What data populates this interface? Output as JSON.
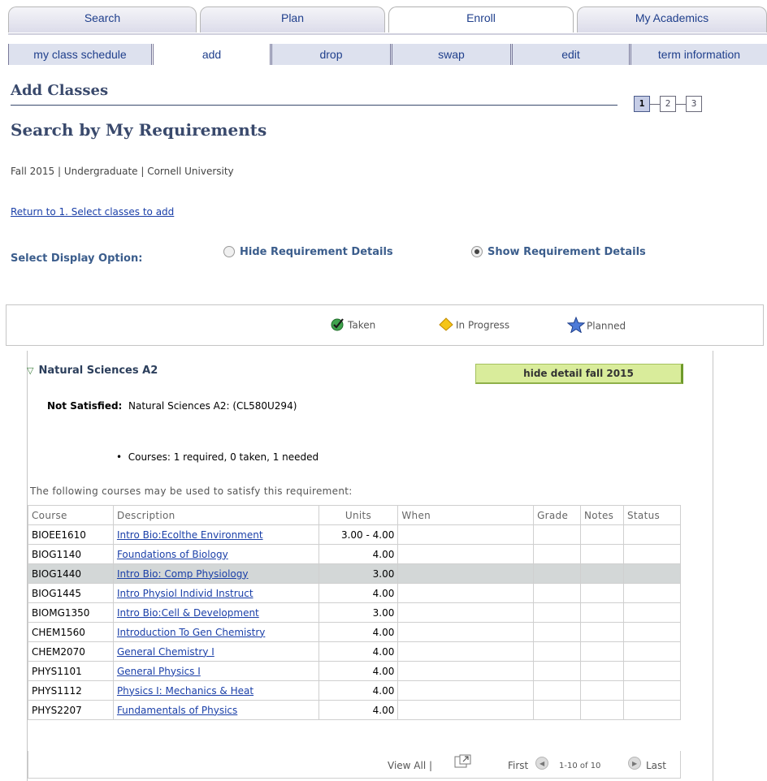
{
  "tabs": [
    {
      "label": "Search"
    },
    {
      "label": "Plan"
    },
    {
      "label": "Enroll"
    },
    {
      "label": "My Academics"
    }
  ],
  "subnav": [
    {
      "label": "my class schedule"
    },
    {
      "label": "add"
    },
    {
      "label": "drop"
    },
    {
      "label": "swap"
    },
    {
      "label": "edit"
    },
    {
      "label": "term information"
    }
  ],
  "page": {
    "title": "Add Classes",
    "subtitle": "Search by My Requirements",
    "term_line": "Fall 2015 | Undergraduate | Cornell University",
    "return_link": "Return to 1. Select classes to add",
    "steps": [
      "1",
      "2",
      "3"
    ]
  },
  "display_option": {
    "label": "Select Display Option:",
    "hide": "Hide Requirement Details",
    "show": "Show Requirement Details",
    "selected": "show"
  },
  "legend": {
    "taken": "Taken",
    "in_progress": "In Progress",
    "planned": "Planned"
  },
  "requirement": {
    "title": "Natural Sciences A2",
    "hide_button": "hide detail fall 2015",
    "status_label": "Not Satisfied:",
    "status_text": "Natural Sciences A2: (CL580U294)",
    "courses_summary": "Courses: 1 required, 0 taken, 1 needed",
    "following_text": "The following courses may be used to satisfy this requirement:"
  },
  "table": {
    "headers": [
      "Course",
      "Description",
      "Units",
      "When",
      "Grade",
      "Notes",
      "Status"
    ],
    "rows": [
      {
        "course": "BIOEE1610",
        "description": "Intro Bio:Ecolthe Environment",
        "units": "3.00 - 4.00"
      },
      {
        "course": "BIOG1140",
        "description": "Foundations of Biology",
        "units": "4.00"
      },
      {
        "course": "BIOG1440",
        "description": "Intro Bio: Comp Physiology",
        "units": "3.00"
      },
      {
        "course": "BIOG1445",
        "description": "Intro Physiol Individ Instruct",
        "units": "4.00"
      },
      {
        "course": "BIOMG1350",
        "description": "Intro Bio:Cell & Development",
        "units": "3.00"
      },
      {
        "course": "CHEM1560",
        "description": "Introduction To Gen Chemistry",
        "units": "4.00"
      },
      {
        "course": "CHEM2070",
        "description": "General Chemistry I",
        "units": "4.00"
      },
      {
        "course": "PHYS1101",
        "description": "General Physics I",
        "units": "4.00"
      },
      {
        "course": "PHYS1112",
        "description": "Physics I: Mechanics & Heat",
        "units": "4.00"
      },
      {
        "course": "PHYS2207",
        "description": "Fundamentals of Physics",
        "units": "4.00"
      }
    ],
    "highlighted_row": 2
  },
  "pager": {
    "view_all": "View All |",
    "first": "First",
    "range": "1-10 of 10",
    "last": "Last"
  }
}
